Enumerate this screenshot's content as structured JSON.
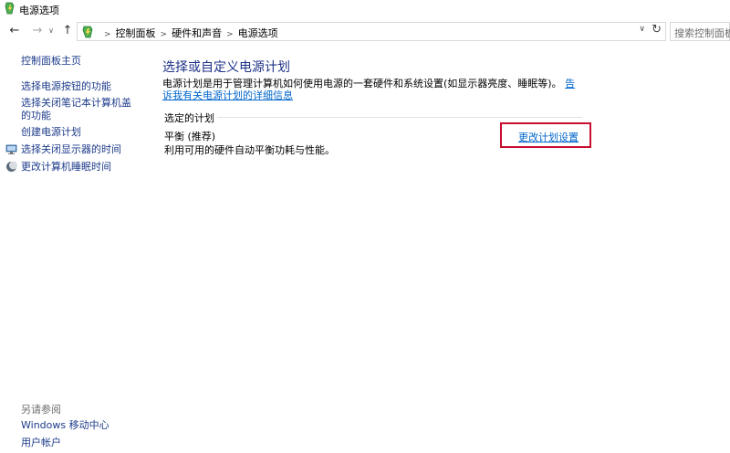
{
  "window": {
    "title": "电源选项"
  },
  "nav": {
    "back_icon": "arrow-left-icon",
    "forward_icon": "arrow-right-icon",
    "up_icon": "arrow-up-icon",
    "breadcrumb": [
      "控制面板",
      "硬件和声音",
      "电源选项"
    ],
    "search_placeholder": "搜索控制面板"
  },
  "sidebar": {
    "home": "控制面板主页",
    "items": [
      {
        "label": "选择电源按钮的功能"
      },
      {
        "label": "选择关闭笔记本计算机盖的功能"
      },
      {
        "label": "创建电源计划"
      },
      {
        "label": "选择关闭显示器的时间",
        "icon": "display-icon"
      },
      {
        "label": "更改计算机睡眠时间",
        "icon": "moon-icon"
      }
    ],
    "see_also_heading": "另请参阅",
    "see_also": [
      {
        "label": "Windows 移动中心"
      },
      {
        "label": "用户帐户"
      }
    ]
  },
  "main": {
    "title": "选择或自定义电源计划",
    "description": "电源计划是用于管理计算机如何使用电源的一套硬件和系统设置(如显示器亮度、睡眠等)。",
    "description_link": "告诉我有关电源计划的详细信息",
    "section_label": "选定的计划",
    "plan": {
      "name": "平衡 (推荐)",
      "description": "利用可用的硬件自动平衡功耗与性能。",
      "settings_link": "更改计划设置"
    }
  },
  "colors": {
    "link": "#1c3b8a",
    "title": "#1e3287",
    "highlight_border": "#c8102e"
  }
}
